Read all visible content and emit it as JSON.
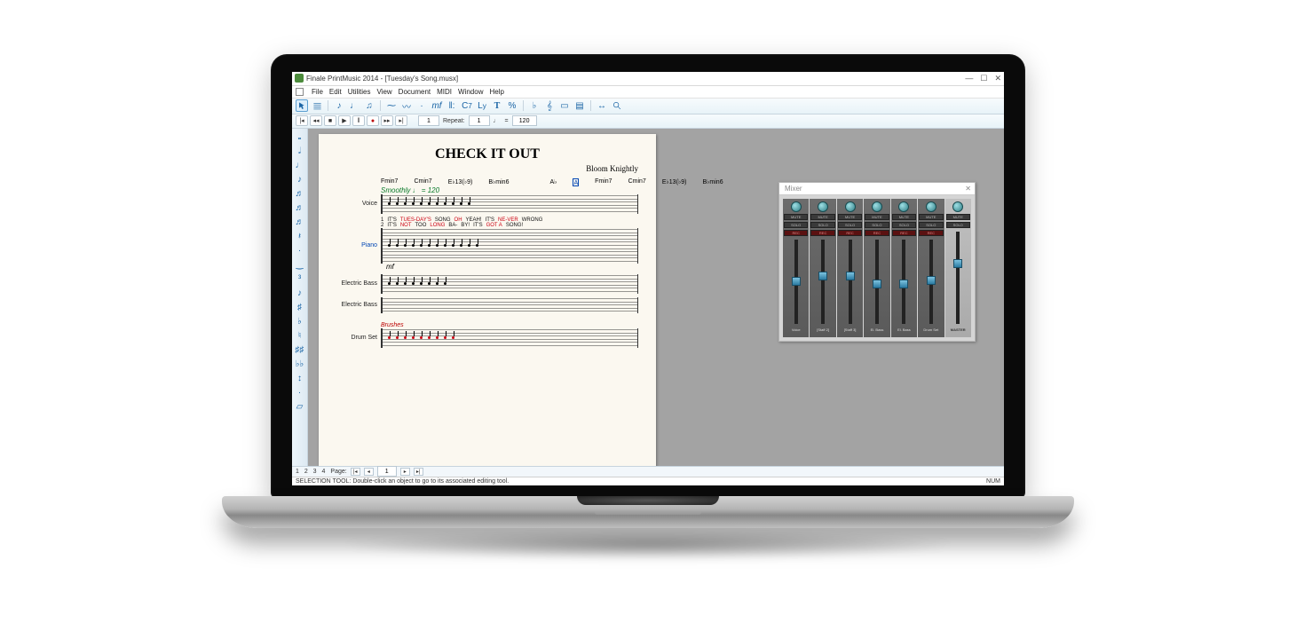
{
  "window": {
    "title": "Finale PrintMusic 2014 - [Tuesday's Song.musx]",
    "minimize": "—",
    "restore": "☐",
    "close": "✕"
  },
  "menubar": [
    "File",
    "Edit",
    "Utilities",
    "View",
    "Document",
    "MIDI",
    "Window",
    "Help"
  ],
  "toolbar_names": [
    "selection",
    "staff",
    "simple-entry",
    "speedy-entry",
    "hyperscribe",
    "tuplet",
    "smart-shape",
    "articulation",
    "expression",
    "repeat",
    "chord",
    "lyrics",
    "text",
    "time-signature",
    "key-signature",
    "clef",
    "measure",
    "page-layout",
    "resize",
    "zoom"
  ],
  "transport": {
    "measure_label": "",
    "measure_value": "1",
    "repeat_label": "Repeat:",
    "repeat_value": "1",
    "tempo_note": "♩",
    "tempo_equals": "=",
    "tempo_value": "120"
  },
  "palette_names": [
    "note-whole",
    "note-half",
    "note-quarter",
    "note-8th",
    "note-16th",
    "note-32nd",
    "note-64th",
    "note-128th",
    "rest",
    "dot",
    "tie",
    "tuplet-tool",
    "grace",
    "sharp",
    "flat",
    "natural",
    "double-sharp",
    "double-flat",
    "enharm",
    "articulation-entry"
  ],
  "score": {
    "title": "CHECK IT OUT",
    "composer": "Bloom Knightly",
    "tempo_marking": "Smoothly ♩ = 120",
    "rehearsal": "A",
    "chords_sys1_left": [
      "Fmin7",
      "Cmin7",
      "E♭13(♭9)",
      "B♭min6"
    ],
    "chords_sys1_right": [
      "A♭",
      "Fmin7",
      "Cmin7",
      "E♭13(♭9)",
      "B♭min6"
    ],
    "instruments": {
      "voice": "Voice",
      "piano": "Piano",
      "ebass": "Electric Bass",
      "ebass2": "Electric Bass",
      "drums": "Drum Set"
    },
    "lyrics1": [
      "1",
      "IT'S",
      "TUES-DAY'S",
      "SONG",
      "OH",
      "YEAH!",
      "IT'S",
      "NE-VER",
      "WRONG"
    ],
    "lyrics2": [
      "2",
      "IT'S",
      "NOT",
      "TOO",
      "LONG",
      "BA-",
      "BY!",
      "IT'S",
      "GOT A",
      "SONG!"
    ],
    "dynamic": "mf",
    "drum_text": "Brushes"
  },
  "mixer": {
    "title": "Mixer",
    "close": "✕",
    "btn_mute": "MUTE",
    "btn_solo": "SOLO",
    "btn_rec": "REC",
    "channels": [
      {
        "name": "Voice",
        "fader": 45
      },
      {
        "name": "[Staff 2]",
        "fader": 38
      },
      {
        "name": "[Staff 3]",
        "fader": 38
      },
      {
        "name": "El. Bass",
        "fader": 48
      },
      {
        "name": "El. Bass",
        "fader": 48
      },
      {
        "name": "Drum Set",
        "fader": 44
      }
    ],
    "master": {
      "name": "MASTER",
      "fader": 30
    }
  },
  "footer": {
    "view_layers": "1 2 3 4",
    "page_label": "Page:",
    "page_value": "1"
  },
  "status": {
    "hint": "SELECTION TOOL: Double-click an object to go to its associated editing tool.",
    "indicator": "NUM"
  }
}
